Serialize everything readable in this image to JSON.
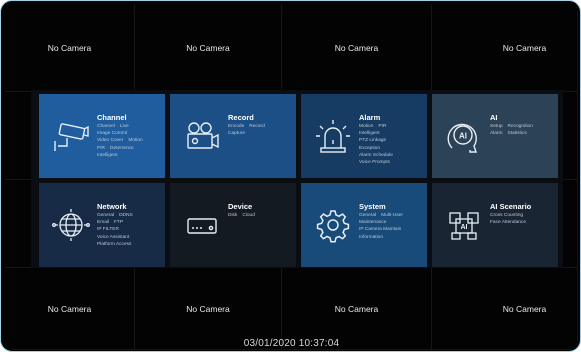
{
  "cameras": [
    {
      "label": "No Camera"
    },
    {
      "label": "No Camera"
    },
    {
      "label": "No Camera"
    },
    {
      "label": "No Camera"
    },
    {
      "label": "No Camera"
    },
    {
      "label": "No Camera"
    },
    {
      "label": "No Camera"
    },
    {
      "label": "No Camera"
    }
  ],
  "menu": {
    "channel": {
      "title": "Channel",
      "items": [
        "Channel",
        "Live",
        "Image Control",
        "Video Cover",
        "Motion",
        "PIR",
        "Deterrence",
        "Intelligent"
      ],
      "icon": "camera-icon"
    },
    "record": {
      "title": "Record",
      "items": [
        "Encode",
        "Record",
        "Capture"
      ],
      "icon": "video-camera-icon"
    },
    "alarm": {
      "title": "Alarm",
      "items": [
        "Motion",
        "PIR",
        "Intelligent",
        "PTZ Linkage",
        "Exception",
        "Alarm Schedule",
        "Voice Prompts"
      ],
      "icon": "alarm-light-icon"
    },
    "ai": {
      "title": "AI",
      "items": [
        "Setup",
        "Recognition",
        "Alarm",
        "Statistics"
      ],
      "icon": "ai-head-icon"
    },
    "network": {
      "title": "Network",
      "items": [
        "General",
        "DDNS",
        "Email",
        "FTP",
        "IP FILTER",
        "Voice Assistant",
        "Platform Access"
      ],
      "icon": "globe-icon"
    },
    "device": {
      "title": "Device",
      "items": [
        "Disk",
        "Cloud"
      ],
      "icon": "disk-icon"
    },
    "system": {
      "title": "System",
      "items": [
        "General",
        "Multi-User",
        "Maintenance",
        "IP Camera Maintain",
        "Information"
      ],
      "icon": "gear-icon"
    },
    "ai_scenario": {
      "title": "AI Scenario",
      "items": [
        "Cross Counting",
        "Face Attendance"
      ],
      "icon": "ai-scenario-icon"
    }
  },
  "status": {
    "datetime": "03/01/2020 10:37:04"
  },
  "colors": {
    "background": "#030303",
    "frame_border": "#9fd2e6"
  }
}
